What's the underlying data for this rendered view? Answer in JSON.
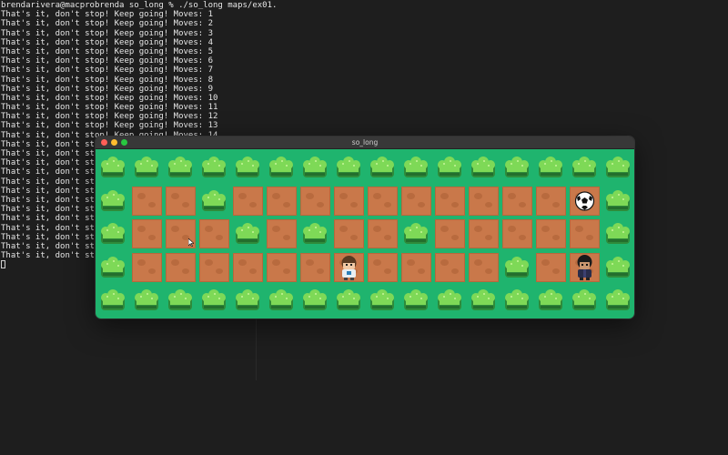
{
  "terminal": {
    "prompt": "brendarivera@macprobrenda so_long % ./so_long maps/ex01.",
    "output_prefix": "That's it, don't stop! Keep going! Moves: ",
    "output_prefix_partial": "That's it, don't stop",
    "moves_full": [
      1,
      2,
      3,
      4,
      5,
      6,
      7,
      8,
      9,
      10,
      11,
      12,
      13,
      14
    ],
    "partial_line_count": 13
  },
  "window": {
    "title": "so_long"
  },
  "game": {
    "map_rows": [
      "1111111111111111",
      "1001000000000001",
      "1000101001000001",
      "1000000000001001",
      "1111111111111111"
    ],
    "collectible": {
      "row": 1,
      "col": 14,
      "icon": "soccer-ball-icon"
    },
    "player": {
      "row": 3,
      "col": 7,
      "icon": "player-boy-icon"
    },
    "exit": {
      "row": 3,
      "col": 14,
      "icon": "character-exit-icon"
    }
  },
  "colors": {
    "terminal_bg": "#1e1e1e",
    "grass": "#1fb46e",
    "dirt": "#c9784a",
    "bush_light": "#7ed957",
    "bush_dark": "#2e8b3a"
  }
}
